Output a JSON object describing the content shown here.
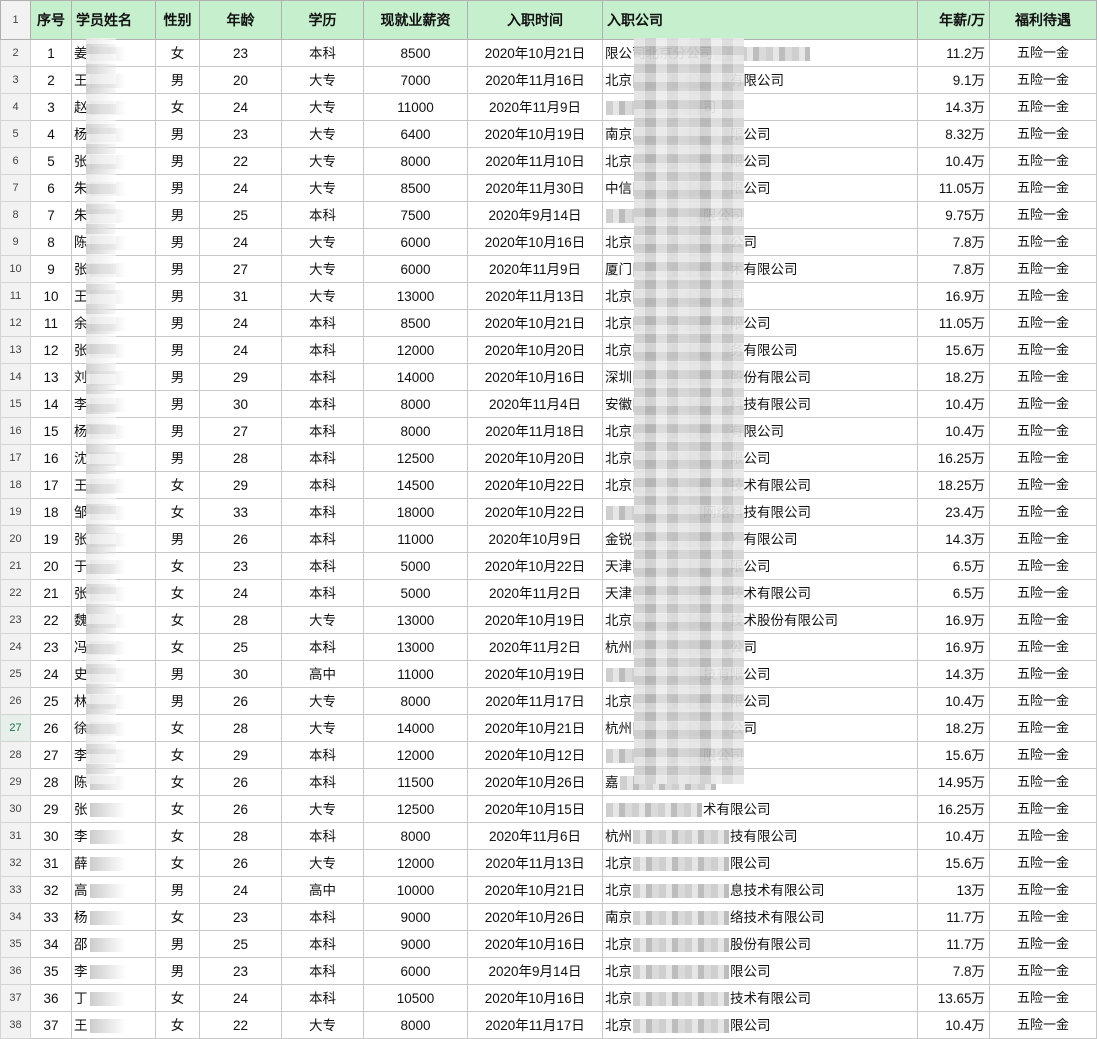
{
  "sheet": {
    "header_row_number": "1",
    "headers": [
      "序号",
      "学员姓名",
      "性别",
      "年龄",
      "学历",
      "现就业薪资",
      "入职时间",
      "入职公司",
      "年薪/万",
      "福利待遇"
    ],
    "active_row_number": "27",
    "rows": [
      {
        "rn": "2",
        "no": "1",
        "name": "姜",
        "gender": "女",
        "age": "23",
        "edu": "本科",
        "salary": "8500",
        "date": "2020年10月21日",
        "company": "限公司北京分公司",
        "annual": "11.2万",
        "welfare": "五险一金"
      },
      {
        "rn": "3",
        "no": "2",
        "name": "王",
        "gender": "男",
        "age": "20",
        "edu": "大专",
        "salary": "7000",
        "date": "2020年11月16日",
        "company": "北京",
        "company_tail": "有限公司",
        "annual": "9.1万",
        "welfare": "五险一金"
      },
      {
        "rn": "4",
        "no": "3",
        "name": "赵",
        "gender": "女",
        "age": "24",
        "edu": "大专",
        "salary": "11000",
        "date": "2020年11月9日",
        "company": "",
        "company_tail": "司",
        "annual": "14.3万",
        "welfare": "五险一金"
      },
      {
        "rn": "5",
        "no": "4",
        "name": "杨",
        "gender": "男",
        "age": "23",
        "edu": "大专",
        "salary": "6400",
        "date": "2020年10月19日",
        "company": "南京",
        "company_tail": "限公司",
        "annual": "8.32万",
        "welfare": "五险一金"
      },
      {
        "rn": "6",
        "no": "5",
        "name": "张",
        "gender": "男",
        "age": "22",
        "edu": "大专",
        "salary": "8000",
        "date": "2020年11月10日",
        "company": "北京",
        "company_tail": "限公司",
        "annual": "10.4万",
        "welfare": "五险一金"
      },
      {
        "rn": "7",
        "no": "6",
        "name": "朱",
        "gender": "男",
        "age": "24",
        "edu": "大专",
        "salary": "8500",
        "date": "2020年11月30日",
        "company": "中信",
        "company_tail": "限公司",
        "annual": "11.05万",
        "welfare": "五险一金"
      },
      {
        "rn": "8",
        "no": "7",
        "name": "朱",
        "gender": "男",
        "age": "25",
        "edu": "本科",
        "salary": "7500",
        "date": "2020年9月14日",
        "company": "",
        "company_tail": "限公司",
        "annual": "9.75万",
        "welfare": "五险一金"
      },
      {
        "rn": "9",
        "no": "8",
        "name": "陈",
        "gender": "男",
        "age": "24",
        "edu": "大专",
        "salary": "6000",
        "date": "2020年10月16日",
        "company": "北京",
        "company_tail": "公司",
        "annual": "7.8万",
        "welfare": "五险一金"
      },
      {
        "rn": "10",
        "no": "9",
        "name": "张",
        "gender": "男",
        "age": "27",
        "edu": "大专",
        "salary": "6000",
        "date": "2020年11月9日",
        "company": "厦门",
        "company_tail": "术有限公司",
        "annual": "7.8万",
        "welfare": "五险一金"
      },
      {
        "rn": "11",
        "no": "10",
        "name": "王",
        "gender": "男",
        "age": "31",
        "edu": "大专",
        "salary": "13000",
        "date": "2020年11月13日",
        "company": "北京",
        "company_tail": "司",
        "annual": "16.9万",
        "welfare": "五险一金"
      },
      {
        "rn": "12",
        "no": "11",
        "name": "余",
        "gender": "男",
        "age": "24",
        "edu": "本科",
        "salary": "8500",
        "date": "2020年10月21日",
        "company": "北京",
        "company_tail": "限公司",
        "annual": "11.05万",
        "welfare": "五险一金"
      },
      {
        "rn": "13",
        "no": "12",
        "name": "张",
        "gender": "男",
        "age": "24",
        "edu": "本科",
        "salary": "12000",
        "date": "2020年10月20日",
        "company": "北京",
        "company_tail": "务有限公司",
        "annual": "15.6万",
        "welfare": "五险一金"
      },
      {
        "rn": "14",
        "no": "13",
        "name": "刘",
        "gender": "男",
        "age": "29",
        "edu": "本科",
        "salary": "14000",
        "date": "2020年10月16日",
        "company": "深圳",
        "company_tail": "股份有限公司",
        "annual": "18.2万",
        "welfare": "五险一金"
      },
      {
        "rn": "15",
        "no": "14",
        "name": "李",
        "gender": "男",
        "age": "30",
        "edu": "本科",
        "salary": "8000",
        "date": "2020年11月4日",
        "company": "安徽",
        "company_tail": "科技有限公司",
        "annual": "10.4万",
        "welfare": "五险一金"
      },
      {
        "rn": "16",
        "no": "15",
        "name": "杨",
        "gender": "男",
        "age": "27",
        "edu": "本科",
        "salary": "8000",
        "date": "2020年11月18日",
        "company": "北京",
        "company_tail": "有限公司",
        "annual": "10.4万",
        "welfare": "五险一金"
      },
      {
        "rn": "17",
        "no": "16",
        "name": "沈",
        "gender": "男",
        "age": "28",
        "edu": "本科",
        "salary": "12500",
        "date": "2020年10月20日",
        "company": "北京",
        "company_tail": "限公司",
        "annual": "16.25万",
        "welfare": "五险一金"
      },
      {
        "rn": "18",
        "no": "17",
        "name": "王",
        "gender": "女",
        "age": "29",
        "edu": "本科",
        "salary": "14500",
        "date": "2020年10月22日",
        "company": "北京",
        "company_tail": "技术有限公司",
        "annual": "18.25万",
        "welfare": "五险一金"
      },
      {
        "rn": "19",
        "no": "18",
        "name": "邹",
        "gender": "女",
        "age": "33",
        "edu": "本科",
        "salary": "18000",
        "date": "2020年10月22日",
        "company": "",
        "company_tail": "网络科技有限公司",
        "annual": "23.4万",
        "welfare": "五险一金"
      },
      {
        "rn": "20",
        "no": "19",
        "name": "张",
        "gender": "男",
        "age": "26",
        "edu": "本科",
        "salary": "11000",
        "date": "2020年10月9日",
        "company": "金锐",
        "company_tail": "）有限公司",
        "annual": "14.3万",
        "welfare": "五险一金"
      },
      {
        "rn": "21",
        "no": "20",
        "name": "于",
        "gender": "女",
        "age": "23",
        "edu": "本科",
        "salary": "5000",
        "date": "2020年10月22日",
        "company": "天津",
        "company_tail": "限公司",
        "annual": "6.5万",
        "welfare": "五险一金"
      },
      {
        "rn": "22",
        "no": "21",
        "name": "张",
        "gender": "女",
        "age": "24",
        "edu": "本科",
        "salary": "5000",
        "date": "2020年11月2日",
        "company": "天津",
        "company_tail": "技术有限公司",
        "annual": "6.5万",
        "welfare": "五险一金"
      },
      {
        "rn": "23",
        "no": "22",
        "name": "魏",
        "gender": "女",
        "age": "28",
        "edu": "大专",
        "salary": "13000",
        "date": "2020年10月19日",
        "company": "北京",
        "company_tail": "技术股份有限公司",
        "annual": "16.9万",
        "welfare": "五险一金"
      },
      {
        "rn": "24",
        "no": "23",
        "name": "冯",
        "gender": "女",
        "age": "25",
        "edu": "本科",
        "salary": "13000",
        "date": "2020年11月2日",
        "company": "杭州",
        "company_tail": "公司",
        "annual": "16.9万",
        "welfare": "五险一金"
      },
      {
        "rn": "25",
        "no": "24",
        "name": "史",
        "gender": "男",
        "age": "30",
        "edu": "高中",
        "salary": "11000",
        "date": "2020年10月19日",
        "company": "",
        "company_tail": "技有限公司",
        "annual": "14.3万",
        "welfare": "五险一金"
      },
      {
        "rn": "26",
        "no": "25",
        "name": "林",
        "gender": "男",
        "age": "26",
        "edu": "大专",
        "salary": "8000",
        "date": "2020年11月17日",
        "company": "北京",
        "company_tail": "限公司",
        "annual": "10.4万",
        "welfare": "五险一金"
      },
      {
        "rn": "27",
        "no": "26",
        "name": "徐",
        "gender": "女",
        "age": "28",
        "edu": "大专",
        "salary": "14000",
        "date": "2020年10月21日",
        "company": "杭州",
        "company_tail": "公司",
        "annual": "18.2万",
        "welfare": "五险一金"
      },
      {
        "rn": "28",
        "no": "27",
        "name": "李",
        "gender": "女",
        "age": "29",
        "edu": "本科",
        "salary": "12000",
        "date": "2020年10月12日",
        "company": "",
        "company_tail": "限公司",
        "annual": "15.6万",
        "welfare": "五险一金"
      },
      {
        "rn": "29",
        "no": "28",
        "name": "陈",
        "gender": "女",
        "age": "26",
        "edu": "本科",
        "salary": "11500",
        "date": "2020年10月26日",
        "company": "嘉",
        "company_tail": "",
        "annual": "14.95万",
        "welfare": "五险一金"
      },
      {
        "rn": "30",
        "no": "29",
        "name": "张",
        "gender": "女",
        "age": "26",
        "edu": "大专",
        "salary": "12500",
        "date": "2020年10月15日",
        "company": "",
        "company_tail": "术有限公司",
        "annual": "16.25万",
        "welfare": "五险一金"
      },
      {
        "rn": "31",
        "no": "30",
        "name": "李",
        "gender": "女",
        "age": "28",
        "edu": "本科",
        "salary": "8000",
        "date": "2020年11月6日",
        "company": "杭州",
        "company_tail": "技有限公司",
        "annual": "10.4万",
        "welfare": "五险一金"
      },
      {
        "rn": "32",
        "no": "31",
        "name": "薛",
        "gender": "女",
        "age": "26",
        "edu": "大专",
        "salary": "12000",
        "date": "2020年11月13日",
        "company": "北京",
        "company_tail": "限公司",
        "annual": "15.6万",
        "welfare": "五险一金"
      },
      {
        "rn": "33",
        "no": "32",
        "name": "高",
        "gender": "男",
        "age": "24",
        "edu": "高中",
        "salary": "10000",
        "date": "2020年10月21日",
        "company": "北京",
        "company_tail": "息技术有限公司",
        "annual": "13万",
        "welfare": "五险一金"
      },
      {
        "rn": "34",
        "no": "33",
        "name": "杨",
        "gender": "女",
        "age": "23",
        "edu": "本科",
        "salary": "9000",
        "date": "2020年10月26日",
        "company": "南京",
        "company_tail": "络技术有限公司",
        "annual": "11.7万",
        "welfare": "五险一金"
      },
      {
        "rn": "35",
        "no": "34",
        "name": "邵",
        "gender": "男",
        "age": "25",
        "edu": "本科",
        "salary": "9000",
        "date": "2020年10月16日",
        "company": "北京",
        "company_tail": "股份有限公司",
        "annual": "11.7万",
        "welfare": "五险一金"
      },
      {
        "rn": "36",
        "no": "35",
        "name": "李",
        "gender": "男",
        "age": "23",
        "edu": "本科",
        "salary": "6000",
        "date": "2020年9月14日",
        "company": "北京",
        "company_tail": "限公司",
        "annual": "7.8万",
        "welfare": "五险一金"
      },
      {
        "rn": "37",
        "no": "36",
        "name": "丁",
        "gender": "女",
        "age": "24",
        "edu": "本科",
        "salary": "10500",
        "date": "2020年10月16日",
        "company": "北京",
        "company_tail": "技术有限公司",
        "annual": "13.65万",
        "welfare": "五险一金"
      },
      {
        "rn": "38",
        "no": "37",
        "name": "王",
        "gender": "女",
        "age": "22",
        "edu": "大专",
        "salary": "8000",
        "date": "2020年11月17日",
        "company": "北京",
        "company_tail": "限公司",
        "annual": "10.4万",
        "welfare": "五险一金"
      }
    ]
  }
}
